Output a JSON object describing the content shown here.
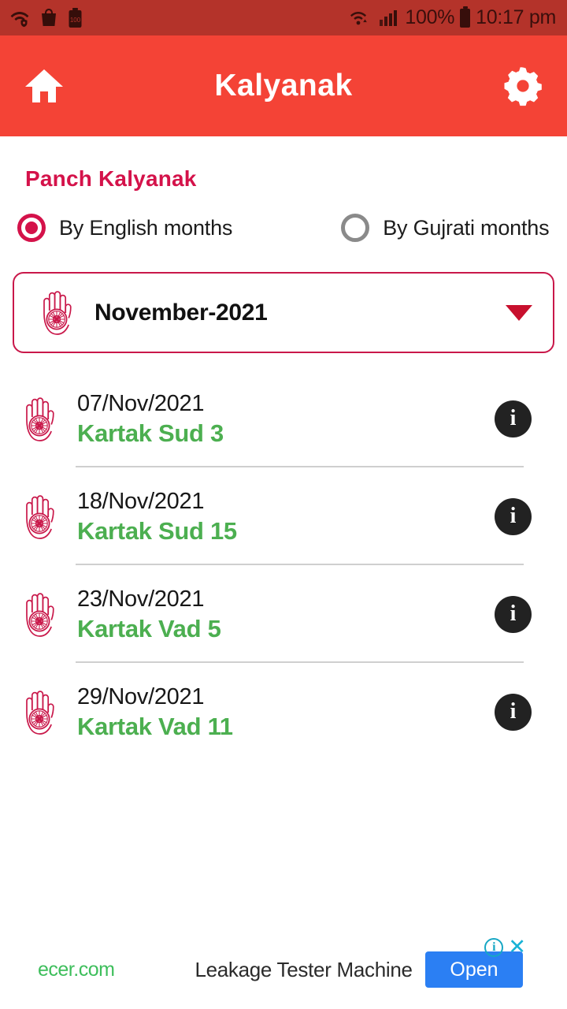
{
  "status_bar": {
    "background": "#B4332A",
    "left_icons": [
      "wifi-protected-icon",
      "shopping-bag-icon",
      "battery-saver-100-icon"
    ],
    "right_icons": [
      "wifi-icon",
      "cellular-signal-icon"
    ],
    "battery_percent": "100%",
    "time": "10:17 pm"
  },
  "app_bar": {
    "background": "#F44336",
    "title": "Kalyanak",
    "home_icon": "home-icon",
    "settings_icon": "gear-icon"
  },
  "main": {
    "section_title": "Panch Kalyanak",
    "accent_color": "#D4124A",
    "month_name_color": "#4CAF50",
    "calendar_mode": {
      "selected": "english",
      "options": [
        {
          "id": "english",
          "label": "By English months",
          "selected": true
        },
        {
          "id": "gujrati",
          "label": "By Gujrati months",
          "selected": false
        }
      ]
    },
    "month_dropdown": {
      "icon": "jain-ahimsa-hand-icon",
      "value": "November-2021",
      "caret_icon": "chevron-down-icon"
    },
    "events": [
      {
        "icon": "jain-ahimsa-hand-icon",
        "date": "07/Nov/2021",
        "tithi": "Kartak Sud 3",
        "info_icon": "info-icon"
      },
      {
        "icon": "jain-ahimsa-hand-icon",
        "date": "18/Nov/2021",
        "tithi": "Kartak Sud 15",
        "info_icon": "info-icon"
      },
      {
        "icon": "jain-ahimsa-hand-icon",
        "date": "23/Nov/2021",
        "tithi": "Kartak Vad 5",
        "info_icon": "info-icon"
      },
      {
        "icon": "jain-ahimsa-hand-icon",
        "date": "29/Nov/2021",
        "tithi": "Kartak Vad 11",
        "info_icon": "info-icon"
      }
    ]
  },
  "ad_banner": {
    "brand": "ecer.com",
    "headline": "Leakage Tester Machine",
    "cta_label": "Open",
    "cta_color": "#2B7FF3",
    "adchoices_icon": "adchoices-info-icon",
    "close_icon": "close-icon"
  }
}
